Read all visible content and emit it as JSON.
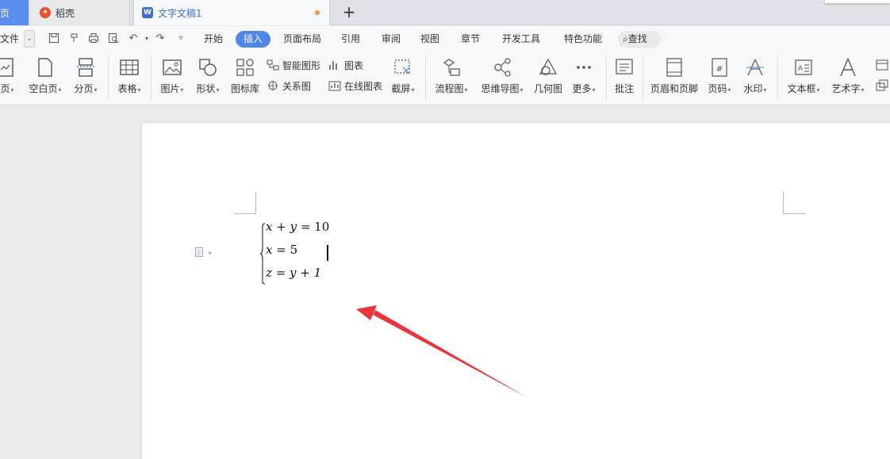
{
  "tabs": {
    "home": "页",
    "daoke": "稻壳",
    "doc": "文字文稿1",
    "new_tab": "+"
  },
  "menubar": {
    "file": "文件",
    "items": [
      "开始",
      "插入",
      "页面布局",
      "引用",
      "审阅",
      "视图",
      "章节",
      "开发工具",
      "特色功能"
    ],
    "active": "插入",
    "search": "查找"
  },
  "ribbon": {
    "cover_page": "页",
    "blank_page": "空白页",
    "page_break": "分页",
    "table": "表格",
    "picture": "图片",
    "shape": "形状",
    "icon_library": "图标库",
    "smart_art": "智能图形",
    "chart": "图表",
    "relation": "关系图",
    "online_chart": "在线图表",
    "screenshot": "截屏",
    "flowchart": "流程图",
    "mindmap": "思维导图",
    "geometry": "几何图",
    "more": "更多",
    "comment": "批注",
    "header_footer": "页眉和页脚",
    "page_number": "页码",
    "watermark": "水印",
    "textbox": "文本框",
    "wordart": "艺术字"
  },
  "document": {
    "equations": {
      "line1": {
        "lhs": "x + y",
        "rhs": "10"
      },
      "line2": {
        "lhs": "x",
        "rhs": "5"
      },
      "line3": {
        "lhs": "z",
        "rhs": "y + 1"
      }
    }
  },
  "colors": {
    "accent": "#4e86ea",
    "arrow": "#e8363a",
    "tab_dirty": "#f39a3b"
  }
}
